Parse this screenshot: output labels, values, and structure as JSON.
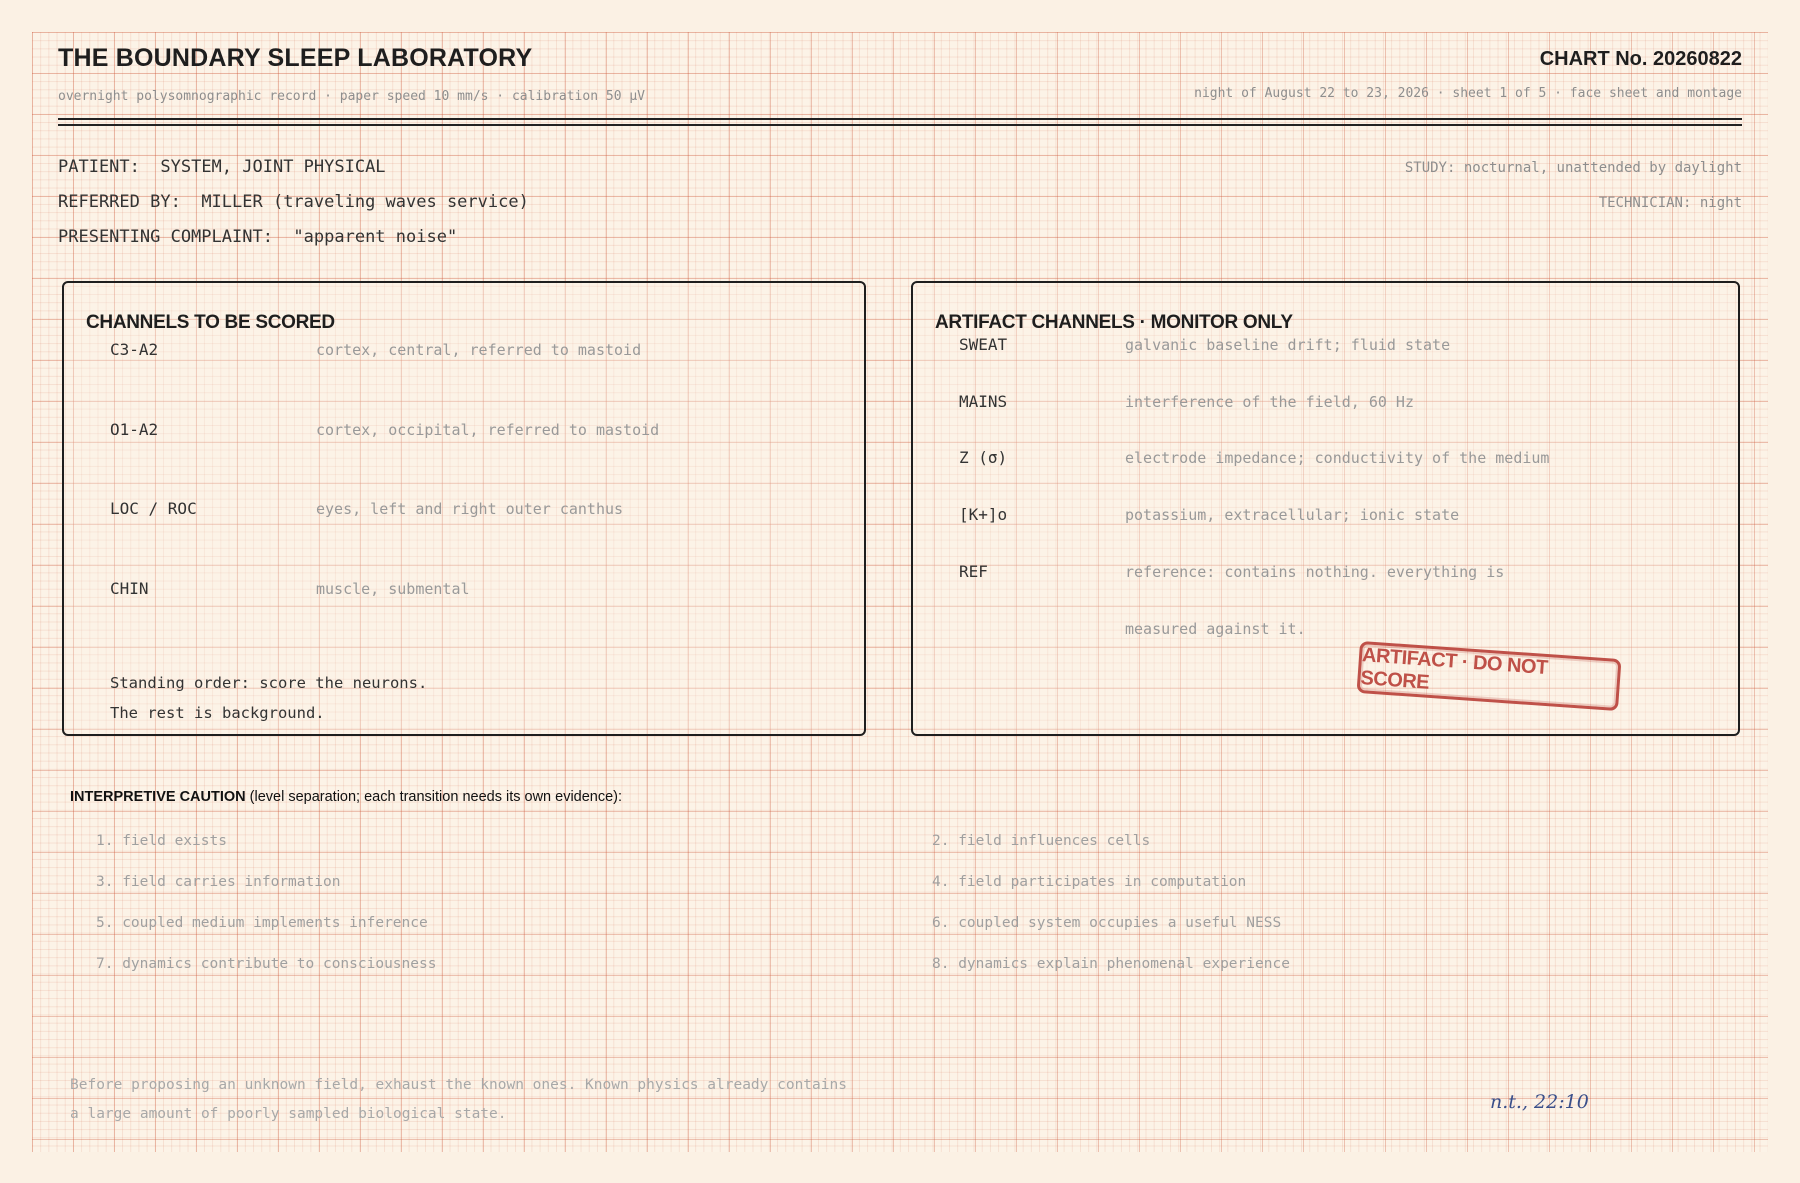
{
  "header": {
    "title": "THE BOUNDARY SLEEP LABORATORY",
    "chart_no": "CHART No. 20260822",
    "subtitle_left": "overnight polysomnographic record  ·  paper speed 10 mm/s  ·  calibration 50 µV",
    "subtitle_right": "night of August 22 to 23, 2026  ·  sheet 1 of 5 · face sheet and montage"
  },
  "patient": {
    "patient_label": "PATIENT:",
    "patient_value": "SYSTEM, JOINT PHYSICAL",
    "referred_label": "REFERRED BY:",
    "referred_value": "MILLER (traveling waves service)",
    "complaint_label": "PRESENTING COMPLAINT:",
    "complaint_value": "\"apparent noise\"",
    "study": "STUDY: nocturnal, unattended by daylight",
    "technician": "TECHNICIAN: night"
  },
  "scored": {
    "title": "CHANNELS TO BE SCORED",
    "channels": [
      {
        "code": "C3-A2",
        "desc": "cortex, central, referred to mastoid"
      },
      {
        "code": "O1-A2",
        "desc": "cortex, occipital, referred to mastoid"
      },
      {
        "code": "LOC / ROC",
        "desc": "eyes, left and right outer canthus"
      },
      {
        "code": "CHIN",
        "desc": "muscle, submental"
      }
    ],
    "order_line1": "Standing order: score the neurons.",
    "order_line2": "The rest is background."
  },
  "artifact": {
    "title": "ARTIFACT CHANNELS · MONITOR ONLY",
    "channels": [
      {
        "code": "SWEAT",
        "desc": "galvanic baseline drift; fluid state"
      },
      {
        "code": "MAINS",
        "desc": "interference of the field, 60 Hz"
      },
      {
        "code": "Z (σ)",
        "desc": "electrode impedance; conductivity of the medium"
      },
      {
        "code": "[K+]o",
        "desc": "potassium, extracellular; ionic state"
      },
      {
        "code": "REF",
        "desc": "reference: contains nothing. everything is"
      }
    ],
    "desc_continuation": "measured against it.",
    "stamp": "ARTIFACT · DO NOT SCORE"
  },
  "caution": {
    "heading_bold": "INTERPRETIVE CAUTION",
    "heading_rest": " (level separation; each transition needs its own evidence):",
    "items": [
      "1. field exists",
      "2. field influences cells",
      "3. field carries information",
      "4. field participates in computation",
      "5. coupled medium implements inference",
      "6. coupled system occupies a useful NESS",
      "7. dynamics contribute to consciousness",
      "8. dynamics explain phenomenal experience"
    ]
  },
  "footer": {
    "line1": "Before proposing an unknown field, exhaust the known ones. Known physics already contains",
    "line2": "a large amount of poorly sampled biological state.",
    "signature": "n.t., 22:10"
  }
}
